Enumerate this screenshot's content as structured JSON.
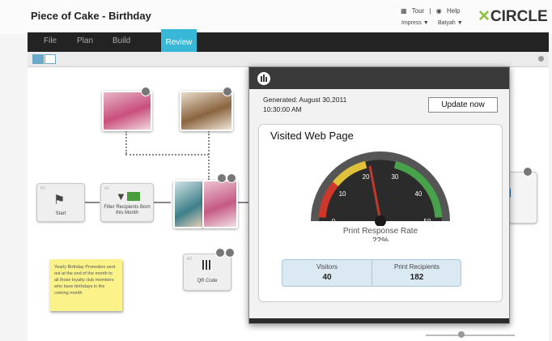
{
  "app": {
    "title": "Piece of Cake - Birthday",
    "tour": "Tour",
    "help": "Help",
    "impress": "Impress ▼",
    "user": "Batyah ▼",
    "logo": "CIRCLE"
  },
  "nav": {
    "tabs": [
      {
        "label": "File"
      },
      {
        "label": "Plan"
      },
      {
        "label": "Build"
      },
      {
        "label": "Review"
      }
    ],
    "active": "Review"
  },
  "flow": {
    "start_label": "Start",
    "filter_label": "Filter Recipients Born this Month",
    "qr_label": "QR Code",
    "start_tag": "P1",
    "filter_tag": "A1",
    "qr_tag": "A2"
  },
  "note": {
    "text": "Yearly Birthday Promotion sent out at the end of the month to all those loyalty club members who have birthdays in the coming month"
  },
  "popup": {
    "generated_line1": "Generated: August 30,2011",
    "generated_line2": "10:30:00 AM",
    "update_label": "Update now",
    "panel_title": "Visited Web Page",
    "gauge_title": "Print Response Rate",
    "gauge_pct": "22%",
    "gauge_value": 22,
    "gauge_ticks": [
      "0",
      "10",
      "20",
      "30",
      "40",
      "50"
    ],
    "stats": [
      {
        "label": "Visitors",
        "value": "40"
      },
      {
        "label": "Print Recipients",
        "value": "182"
      }
    ]
  },
  "colors": {
    "accent": "#38b8d6",
    "nav_bg": "#232323",
    "logo_green": "#8dc23f",
    "note_yellow": "#fbf28a",
    "gauge_red": "#d0372b",
    "gauge_yellow": "#e0c13a",
    "gauge_green": "#47a24a"
  }
}
